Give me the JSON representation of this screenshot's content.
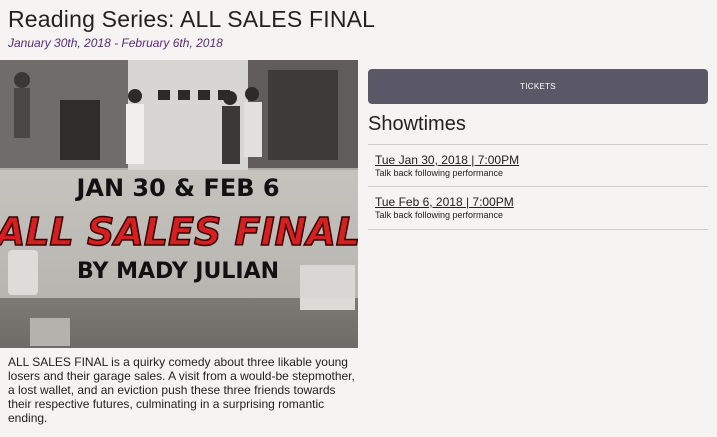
{
  "event": {
    "title": "Reading Series: ALL SALES FINAL",
    "dates": "January 30th, 2018 - February 6th, 2018"
  },
  "poster": {
    "line1": "JAN 30 & FEB 6",
    "line2": "ALL SALES FINAL",
    "line3": "BY MADY JULIAN"
  },
  "description": "ALL SALES FINAL is a quirky comedy about three likable young losers and their garage sales. A visit from a would-be stepmother, a lost wallet, and an eviction push these three friends towards their respective futures, culminating in a surprising romantic ending.",
  "tickets_label": "TICKETS",
  "showtimes_heading": "Showtimes",
  "showtimes": [
    {
      "time": "Tue Jan 30, 2018 | 7:00PM",
      "note": "Talk back following performance"
    },
    {
      "time": "Tue Feb 6, 2018 | 7:00PM",
      "note": "Talk back following performance"
    }
  ],
  "colors": {
    "accent_date": "#5b2a7a",
    "button_bg": "#5a5766",
    "poster_title": "#d42020"
  }
}
